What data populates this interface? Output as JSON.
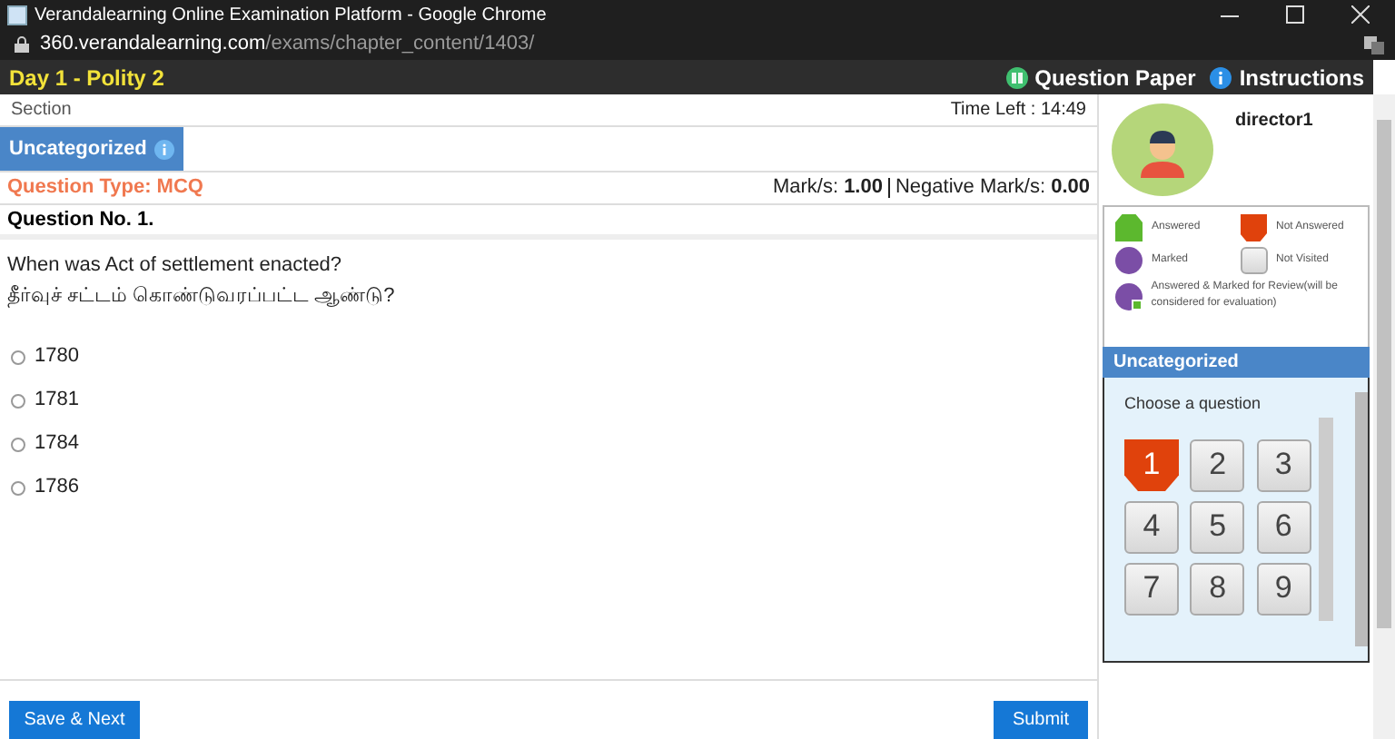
{
  "window": {
    "title": "Verandalearning Online Examination Platform - Google Chrome"
  },
  "address_bar": {
    "domain": "360.verandalearning.com",
    "path": "/exams/chapter_content/1403/"
  },
  "header": {
    "exam_title": "Day 1 - Polity 2",
    "links": [
      {
        "kind": "paper",
        "label": "Question Paper"
      },
      {
        "kind": "info",
        "label": "Instructions"
      }
    ]
  },
  "section_bar": {
    "label": "Section",
    "timer_label": "Time Left :",
    "timer": "14:49"
  },
  "section_tabs": [
    {
      "label": "Uncategorized",
      "selected": true
    }
  ],
  "question_meta": {
    "type": "Question Type: MCQ",
    "marks_label": "Mark/s:",
    "marks": "1.00",
    "negative_label": "Negative Mark/s:",
    "negative": "0.00"
  },
  "question": {
    "number": "Question No. 1.",
    "text": "When was Act of settlement enacted?",
    "text_tamil": "தீர்வுச் சட்டம் கொண்டுவரப்பட்ட ஆண்டு?"
  },
  "options": [
    {
      "label": "1780",
      "selected": false
    },
    {
      "label": "1781",
      "selected": false
    },
    {
      "label": "1784",
      "selected": false
    },
    {
      "label": "1786",
      "selected": false
    }
  ],
  "buttons": {
    "save": "Save & Next",
    "submit": "Submit"
  },
  "user": {
    "name": "director1"
  },
  "legend": [
    {
      "kind": "answered",
      "label": "Answered"
    },
    {
      "kind": "not_answered",
      "label": "Not Answered"
    },
    {
      "kind": "marked",
      "label": "Marked"
    },
    {
      "kind": "not_visited",
      "label": "Not Visited"
    },
    {
      "kind": "answered_marked",
      "label": "Answered & Marked for Review(will be considered for evaluation)"
    }
  ],
  "palette": {
    "section": "Uncategorized",
    "prompt": "Choose a question",
    "questions": [
      {
        "number": "1",
        "kind": "not_answered"
      },
      {
        "number": "2",
        "kind": "not_visited"
      },
      {
        "number": "3",
        "kind": "not_visited"
      },
      {
        "number": "4",
        "kind": "not_visited"
      },
      {
        "number": "5",
        "kind": "not_visited"
      },
      {
        "number": "6",
        "kind": "not_visited"
      },
      {
        "number": "7",
        "kind": "not_visited"
      },
      {
        "number": "8",
        "kind": "not_visited"
      },
      {
        "number": "9",
        "kind": "not_visited"
      }
    ]
  }
}
